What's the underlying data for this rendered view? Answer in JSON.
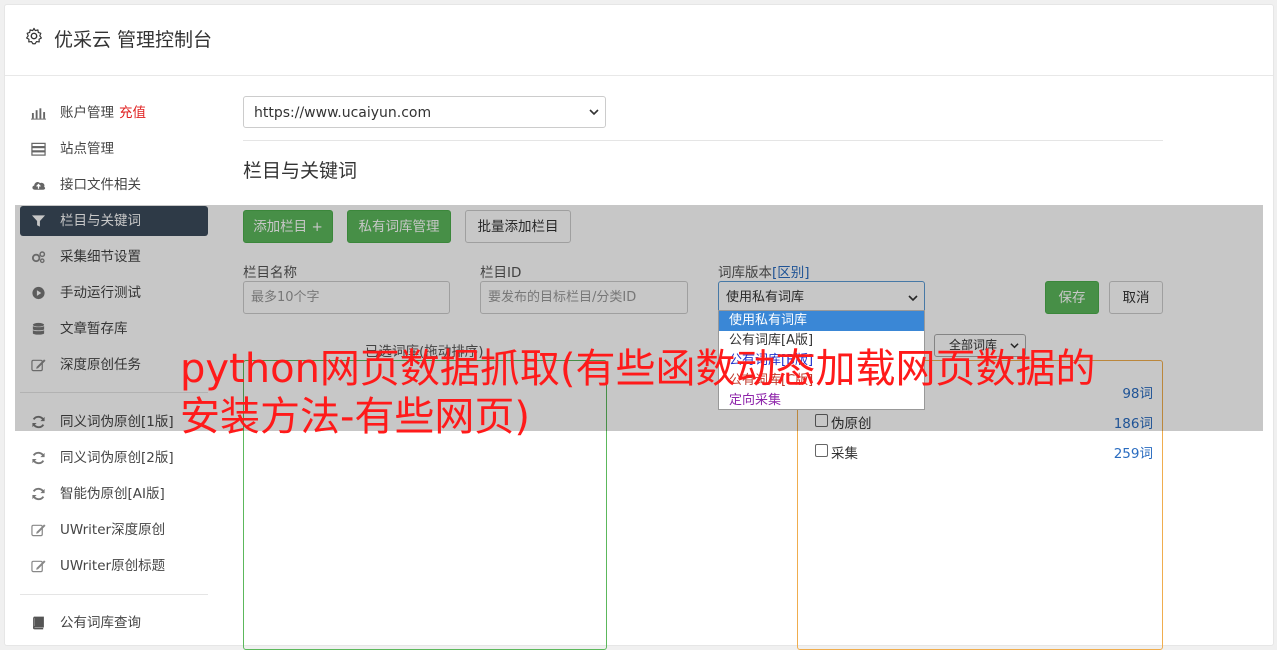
{
  "app": {
    "title": "优采云 管理控制台",
    "icon": "gear-icon"
  },
  "sidebar": {
    "items": [
      {
        "label": "账户管理",
        "badge": "充值",
        "icon": "bar-chart-icon"
      },
      {
        "label": "站点管理",
        "icon": "server-icon"
      },
      {
        "label": "接口文件相关",
        "icon": "cloud-upload-icon"
      },
      {
        "label": "栏目与关键词",
        "icon": "filter-icon",
        "active": true
      },
      {
        "label": "采集细节设置",
        "icon": "cogs-icon"
      },
      {
        "label": "手动运行测试",
        "icon": "play-circle-icon"
      },
      {
        "label": "文章暂存库",
        "icon": "database-icon"
      },
      {
        "label": "深度原创任务",
        "icon": "edit-icon"
      },
      {
        "label": "同义词伪原创[1版]",
        "icon": "refresh-icon"
      },
      {
        "label": "同义词伪原创[2版]",
        "icon": "refresh-icon"
      },
      {
        "label": "智能伪原创[AI版]",
        "icon": "refresh-icon"
      },
      {
        "label": "UWriter深度原创",
        "icon": "edit-icon"
      },
      {
        "label": "UWriter原创标题",
        "icon": "edit-icon"
      },
      {
        "label": "公有词库查询",
        "icon": "book-icon"
      }
    ]
  },
  "main": {
    "site_select": "https://www.ucaiyun.com",
    "section_title": "栏目与关键词",
    "buttons": {
      "add_column": "添加栏目 +",
      "private_lib": "私有词库管理",
      "batch_add": "批量添加栏目",
      "save": "保存",
      "cancel": "取消"
    },
    "form": {
      "name_label": "栏目名称",
      "name_placeholder": "最多10个字",
      "id_label": "栏目ID",
      "id_placeholder": "要发布的目标栏目/分类ID",
      "version_label": "词库版本",
      "version_label_link": "[区别]",
      "version_value": "使用私有词库"
    },
    "dropdown_options": [
      {
        "label": "使用私有词库",
        "color": "#ffffff"
      },
      {
        "label": "公有词库[A版]",
        "color": "#333333"
      },
      {
        "label": "公有词库[B版]",
        "color": "#2233cc"
      },
      {
        "label": "公有词库[C版]",
        "color": "#c0392b"
      },
      {
        "label": "定向采集",
        "color": "#8e24aa"
      }
    ],
    "left_panel_head": "已选词库(拖动排序)",
    "filter_select": "全部词库",
    "libraries": [
      {
        "name": "",
        "count": "98词"
      },
      {
        "name": "伪原创",
        "count": "186词"
      },
      {
        "name": "采集",
        "count": "259词"
      }
    ]
  },
  "overlay_title": "python网页数据抓取(有些函数动态加载网页数据的安装方法-有些网页)"
}
